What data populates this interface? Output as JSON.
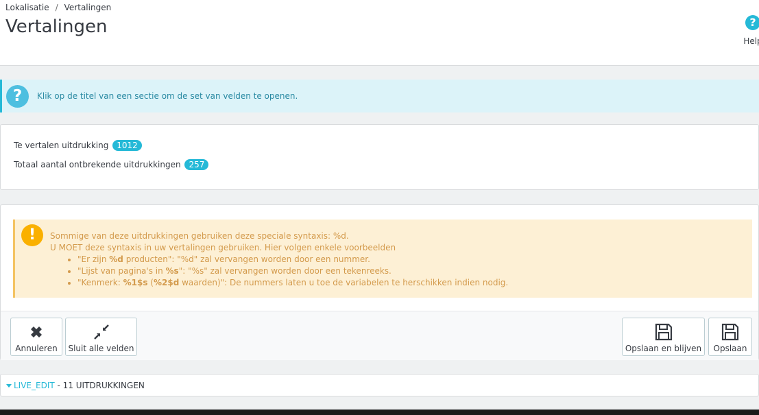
{
  "breadcrumb": {
    "parent": "Lokalisatie",
    "separator": "/",
    "current": "Vertalingen"
  },
  "page_title": "Vertalingen",
  "help": {
    "icon": "?",
    "label": "Help"
  },
  "info_alert": {
    "icon": "?",
    "text": "Klik op de titel van een sectie om de set van velden te openen."
  },
  "stats": {
    "to_translate_label": "Te vertalen uitdrukking",
    "to_translate_count": "1012",
    "missing_label": "Totaal aantal ontbrekende uitdrukkingen",
    "missing_count": "257"
  },
  "warning": {
    "icon": "!",
    "line1": "Sommige van deze uitdrukkingen gebruiken deze speciale syntaxis: %d.",
    "line2": "U MOET deze syntaxis in uw vertalingen gebruiken. Hier volgen enkele voorbeelden",
    "examples": [
      {
        "pre": "\"Er zijn ",
        "bold": "%d",
        "post": " producten\": \"%d\" zal vervangen worden door een nummer."
      },
      {
        "pre": "\"Lijst van pagina's in ",
        "bold": "%s",
        "post": "\": \"%s\" zal vervangen worden door een tekenreeks."
      },
      {
        "pre": "\"Kenmerk: ",
        "bold": "%1$s",
        "mid": " (",
        "bold2": "%2$d",
        "post": " waarden)\": De nummers laten u toe de variabelen te herschikken indien nodig."
      }
    ]
  },
  "toolbar": {
    "cancel_label": "Annuleren",
    "collapse_label": "Sluit alle velden",
    "save_stay_label": "Opslaan en blijven",
    "save_label": "Opslaan"
  },
  "section": {
    "name": "LIVE_EDIT",
    "count_text": " - 11 UITDRUKKINGEN"
  },
  "colors": {
    "accent": "#25b9d7",
    "warning": "#fab000",
    "info_bg": "#dcf3f9",
    "warning_bg": "#fdf0d5"
  }
}
